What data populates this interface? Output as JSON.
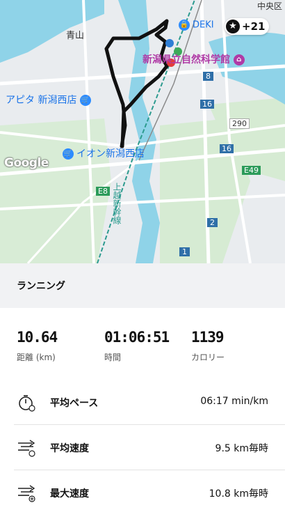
{
  "map": {
    "labels": {
      "aoyama": "青山",
      "dek": "DEKI",
      "museum": "新潟県立自然科学館",
      "apita": "アピタ 新潟西店",
      "aeon": "イオン新潟西店",
      "shinkansen": "上越新幹線",
      "top_right": "中央区"
    },
    "road_numbers": [
      "8",
      "16",
      "16",
      "290",
      "E49",
      "E8",
      "2",
      "1"
    ],
    "google_logo": "Google",
    "badge": {
      "icon": "star-icon",
      "text": "+21"
    }
  },
  "activity": {
    "type_label": "ランニング"
  },
  "stats": [
    {
      "value": "10.64",
      "label": "距離 (km)"
    },
    {
      "value": "01:06:51",
      "label": "時間"
    },
    {
      "value": "1139",
      "label": "カロリー"
    }
  ],
  "metrics": [
    {
      "icon": "stopwatch-icon",
      "label": "平均ペース",
      "value": "06:17 min/km"
    },
    {
      "icon": "average-speed-icon",
      "label": "平均速度",
      "value": "9.5 km毎時"
    },
    {
      "icon": "max-speed-icon",
      "label": "最大速度",
      "value": "10.8 km毎時"
    }
  ],
  "colors": {
    "route": "#111111",
    "river": "#8fd3e8",
    "park": "#cfe8cf",
    "road": "#ffffff",
    "highway": "#2c9b8f",
    "section_bg": "#f1f2f4"
  }
}
